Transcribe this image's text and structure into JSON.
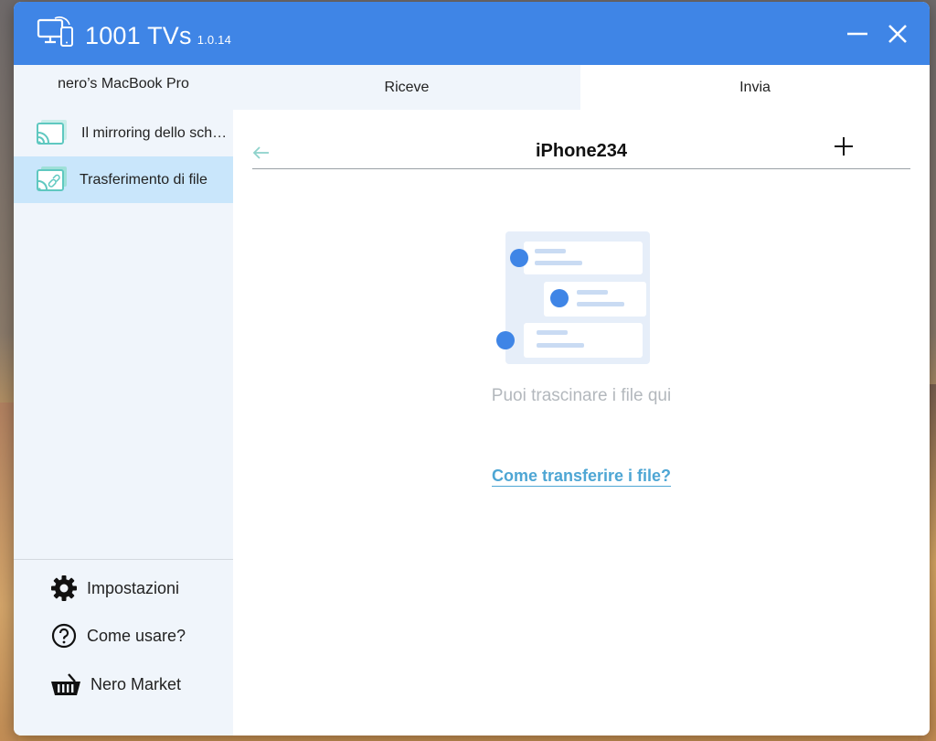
{
  "app": {
    "name": "1001 TVs",
    "version": "1.0.14"
  },
  "sidebar": {
    "device_name": "nero’s MacBook Pro",
    "items": [
      {
        "label": "Il mirroring dello schermo",
        "icon": "cast-screen-icon",
        "active": false
      },
      {
        "label": "Trasferimento di file",
        "icon": "file-transfer-icon",
        "active": true
      }
    ],
    "bottom_items": [
      {
        "label": "Impostazioni",
        "icon": "gear-icon"
      },
      {
        "label": "Come usare?",
        "icon": "help-circle-icon"
      },
      {
        "label": "Nero Market",
        "icon": "basket-icon"
      }
    ]
  },
  "tabs": [
    {
      "label": "Riceve",
      "active": false
    },
    {
      "label": "Invia",
      "active": true
    }
  ],
  "main": {
    "device_title": "iPhone234",
    "drop_hint": "Puoi trascinare i file qui",
    "help_link": "Come transferire i file?"
  },
  "colors": {
    "titlebar": "#3f85e6",
    "accent_blue": "#4285f4",
    "active_item": "#c9e6fb",
    "link": "#4ea6d4",
    "icon_teal": "#5fc8c0"
  }
}
